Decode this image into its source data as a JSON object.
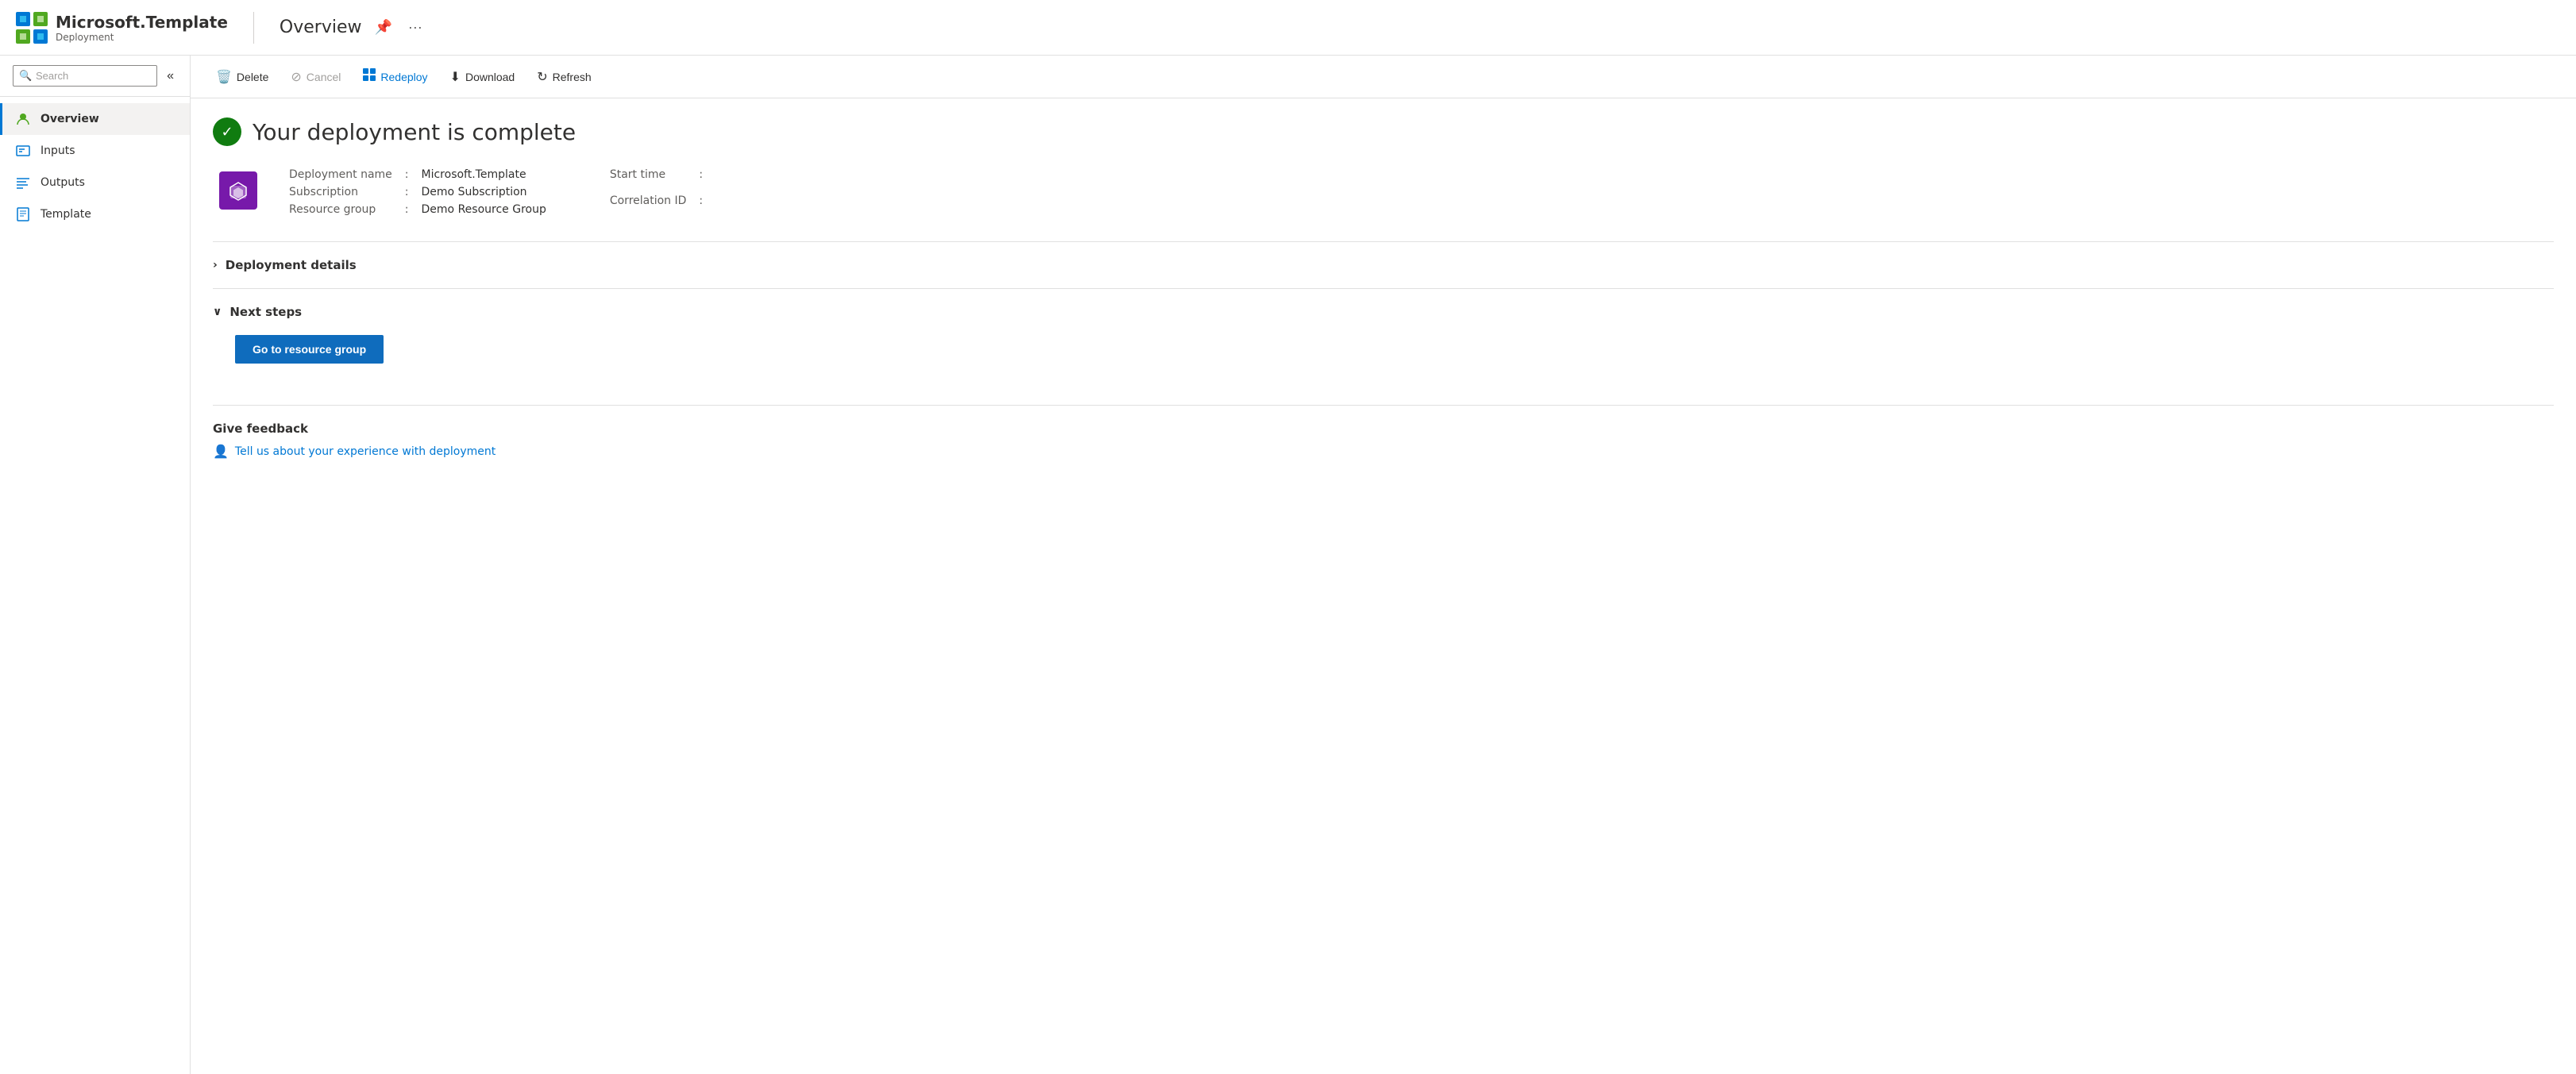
{
  "header": {
    "logo_alt": "Microsoft Azure",
    "title": "Microsoft.Template",
    "subtitle": "Deployment",
    "page_title": "Overview",
    "pin_icon": "📌",
    "more_icon": "···"
  },
  "sidebar": {
    "search_placeholder": "Search",
    "collapse_icon": "«",
    "nav_items": [
      {
        "id": "overview",
        "label": "Overview",
        "active": true
      },
      {
        "id": "inputs",
        "label": "Inputs",
        "active": false
      },
      {
        "id": "outputs",
        "label": "Outputs",
        "active": false
      },
      {
        "id": "template",
        "label": "Template",
        "active": false
      }
    ]
  },
  "toolbar": {
    "delete_label": "Delete",
    "cancel_label": "Cancel",
    "redeploy_label": "Redeploy",
    "download_label": "Download",
    "refresh_label": "Refresh"
  },
  "overview": {
    "status_title": "Your deployment is complete",
    "deployment_name_label": "Deployment name",
    "deployment_name_value": "Microsoft.Template",
    "subscription_label": "Subscription",
    "subscription_value": "Demo Subscription",
    "resource_group_label": "Resource group",
    "resource_group_value": "Demo Resource Group",
    "start_time_label": "Start time",
    "start_time_value": "",
    "correlation_id_label": "Correlation ID",
    "correlation_id_value": "",
    "deployment_details_label": "Deployment details",
    "next_steps_label": "Next steps",
    "goto_resource_group_label": "Go to resource group",
    "feedback_title": "Give feedback",
    "feedback_link_text": "Tell us about your experience with deployment"
  }
}
